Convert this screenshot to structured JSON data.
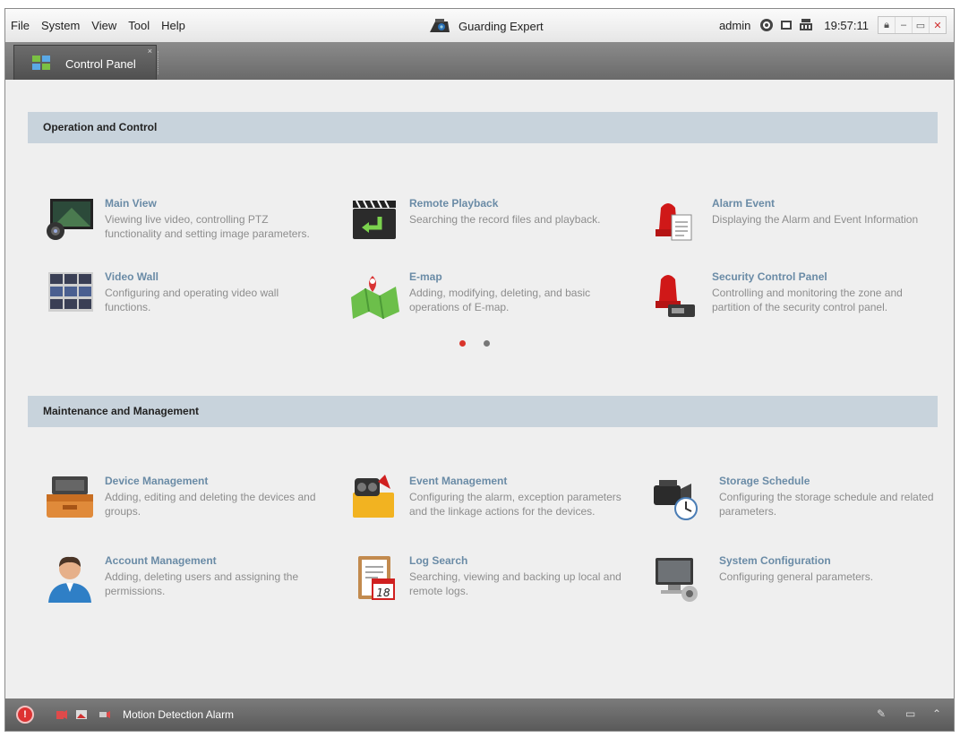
{
  "menu": [
    "File",
    "System",
    "View",
    "Tool",
    "Help"
  ],
  "app_title": "Guarding Expert",
  "user": "admin",
  "clock": "19:57:11",
  "window_buttons": [
    "lock",
    "minimize",
    "maximize",
    "close"
  ],
  "tab": {
    "label": "Control Panel",
    "close": "×"
  },
  "sections": {
    "operation": {
      "title": "Operation and Control",
      "modules": [
        {
          "title": "Main View",
          "desc": "Viewing live video, controlling PTZ functionality and setting image parameters.",
          "icon": "main-view-icon"
        },
        {
          "title": "Remote Playback",
          "desc": "Searching the record files and playback.",
          "icon": "remote-playback-icon"
        },
        {
          "title": "Alarm Event",
          "desc": "Displaying the Alarm and Event Information",
          "icon": "alarm-event-icon"
        },
        {
          "title": "Video Wall",
          "desc": "Configuring and operating video wall functions.",
          "icon": "video-wall-icon"
        },
        {
          "title": "E-map",
          "desc": "Adding, modifying, deleting, and basic operations of E-map.",
          "icon": "emap-icon"
        },
        {
          "title": "Security Control Panel",
          "desc": "Controlling and monitoring the zone and partition of the security control panel.",
          "icon": "security-panel-icon"
        }
      ]
    },
    "maintenance": {
      "title": "Maintenance and Management",
      "modules": [
        {
          "title": "Device Management",
          "desc": "Adding, editing and deleting the devices and groups.",
          "icon": "device-management-icon"
        },
        {
          "title": "Event Management",
          "desc": "Configuring the alarm, exception parameters and the linkage actions for the devices.",
          "icon": "event-management-icon"
        },
        {
          "title": "Storage Schedule",
          "desc": "Configuring the storage schedule and related parameters.",
          "icon": "storage-schedule-icon"
        },
        {
          "title": "Account Management",
          "desc": "Adding, deleting users and assigning the permissions.",
          "icon": "account-management-icon"
        },
        {
          "title": "Log Search",
          "desc": "Searching, viewing and backing up local and remote logs.",
          "icon": "log-search-icon"
        },
        {
          "title": "System Configuration",
          "desc": "Configuring general parameters.",
          "icon": "system-configuration-icon"
        }
      ]
    }
  },
  "pager": {
    "active_page": 1,
    "total_pages": 2,
    "active_color": "#d9342b",
    "inactive_color": "#777777"
  },
  "calendar_day": "18",
  "statusbar": {
    "text": "Motion Detection Alarm"
  },
  "colors": {
    "module_title": "#6a8ba6",
    "section_bg": "#c8d3dc"
  }
}
